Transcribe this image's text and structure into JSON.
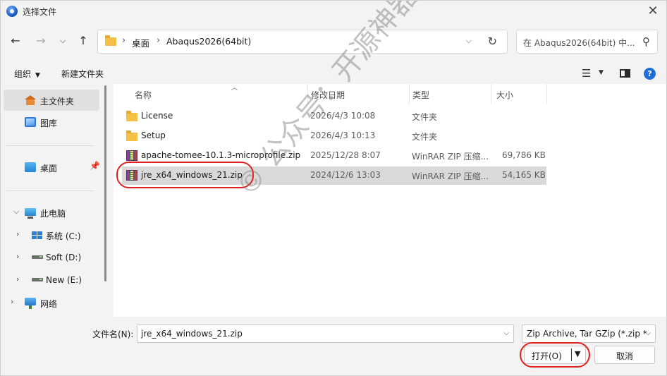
{
  "window": {
    "title": "选择文件"
  },
  "nav": {
    "back_icon": "arrow-left-icon",
    "forward_icon": "arrow-right-icon",
    "recent_icon": "chevron-down-icon",
    "up_icon": "arrow-up-icon",
    "address": [
      "桌面",
      "Abaqus2026(64bit)"
    ],
    "search_placeholder": "在 Abaqus2026(64bit) 中..."
  },
  "toolbar": {
    "organize_label": "组织",
    "new_folder_label": "新建文件夹"
  },
  "sidebar": {
    "items": [
      {
        "label": "主文件夹",
        "icon": "home-icon"
      },
      {
        "label": "图库",
        "icon": "gallery-icon"
      },
      {
        "label": "桌面",
        "icon": "desktop-icon"
      },
      {
        "label": "此电脑",
        "icon": "pc-icon"
      },
      {
        "label": "系统 (C:)",
        "icon": "drive-icon"
      },
      {
        "label": "Soft (D:)",
        "icon": "drive-icon"
      },
      {
        "label": "New (E:)",
        "icon": "drive-icon"
      },
      {
        "label": "网络",
        "icon": "network-icon"
      }
    ]
  },
  "columns": {
    "name": "名称",
    "modified": "修改日期",
    "type": "类型",
    "size": "大小"
  },
  "files": [
    {
      "name": "License",
      "modified": "2026/4/3 10:08",
      "type": "文件夹",
      "size": ""
    },
    {
      "name": "Setup",
      "modified": "2026/4/3 10:13",
      "type": "文件夹",
      "size": ""
    },
    {
      "name": "apache-tomee-10.1.3-microprofile.zip",
      "modified": "2025/12/28 8:07",
      "type": "WinRAR ZIP 压缩...",
      "size": "69,786 KB"
    },
    {
      "name": "jre_x64_windows_21.zip",
      "modified": "2024/12/6 13:03",
      "type": "WinRAR ZIP 压缩...",
      "size": "54,165 KB"
    }
  ],
  "watermark": "© 公众号：开源神器",
  "footer": {
    "filename_label": "文件名(N):",
    "filename_value": "jre_x64_windows_21.zip",
    "filter_value": "Zip Archive, Tar GZip (*.zip *",
    "open_label": "打开(O)",
    "cancel_label": "取消"
  },
  "colors": {
    "accent": "#1e6fd9",
    "highlight": "#e32020",
    "selected_row": "#d9d9d9"
  }
}
